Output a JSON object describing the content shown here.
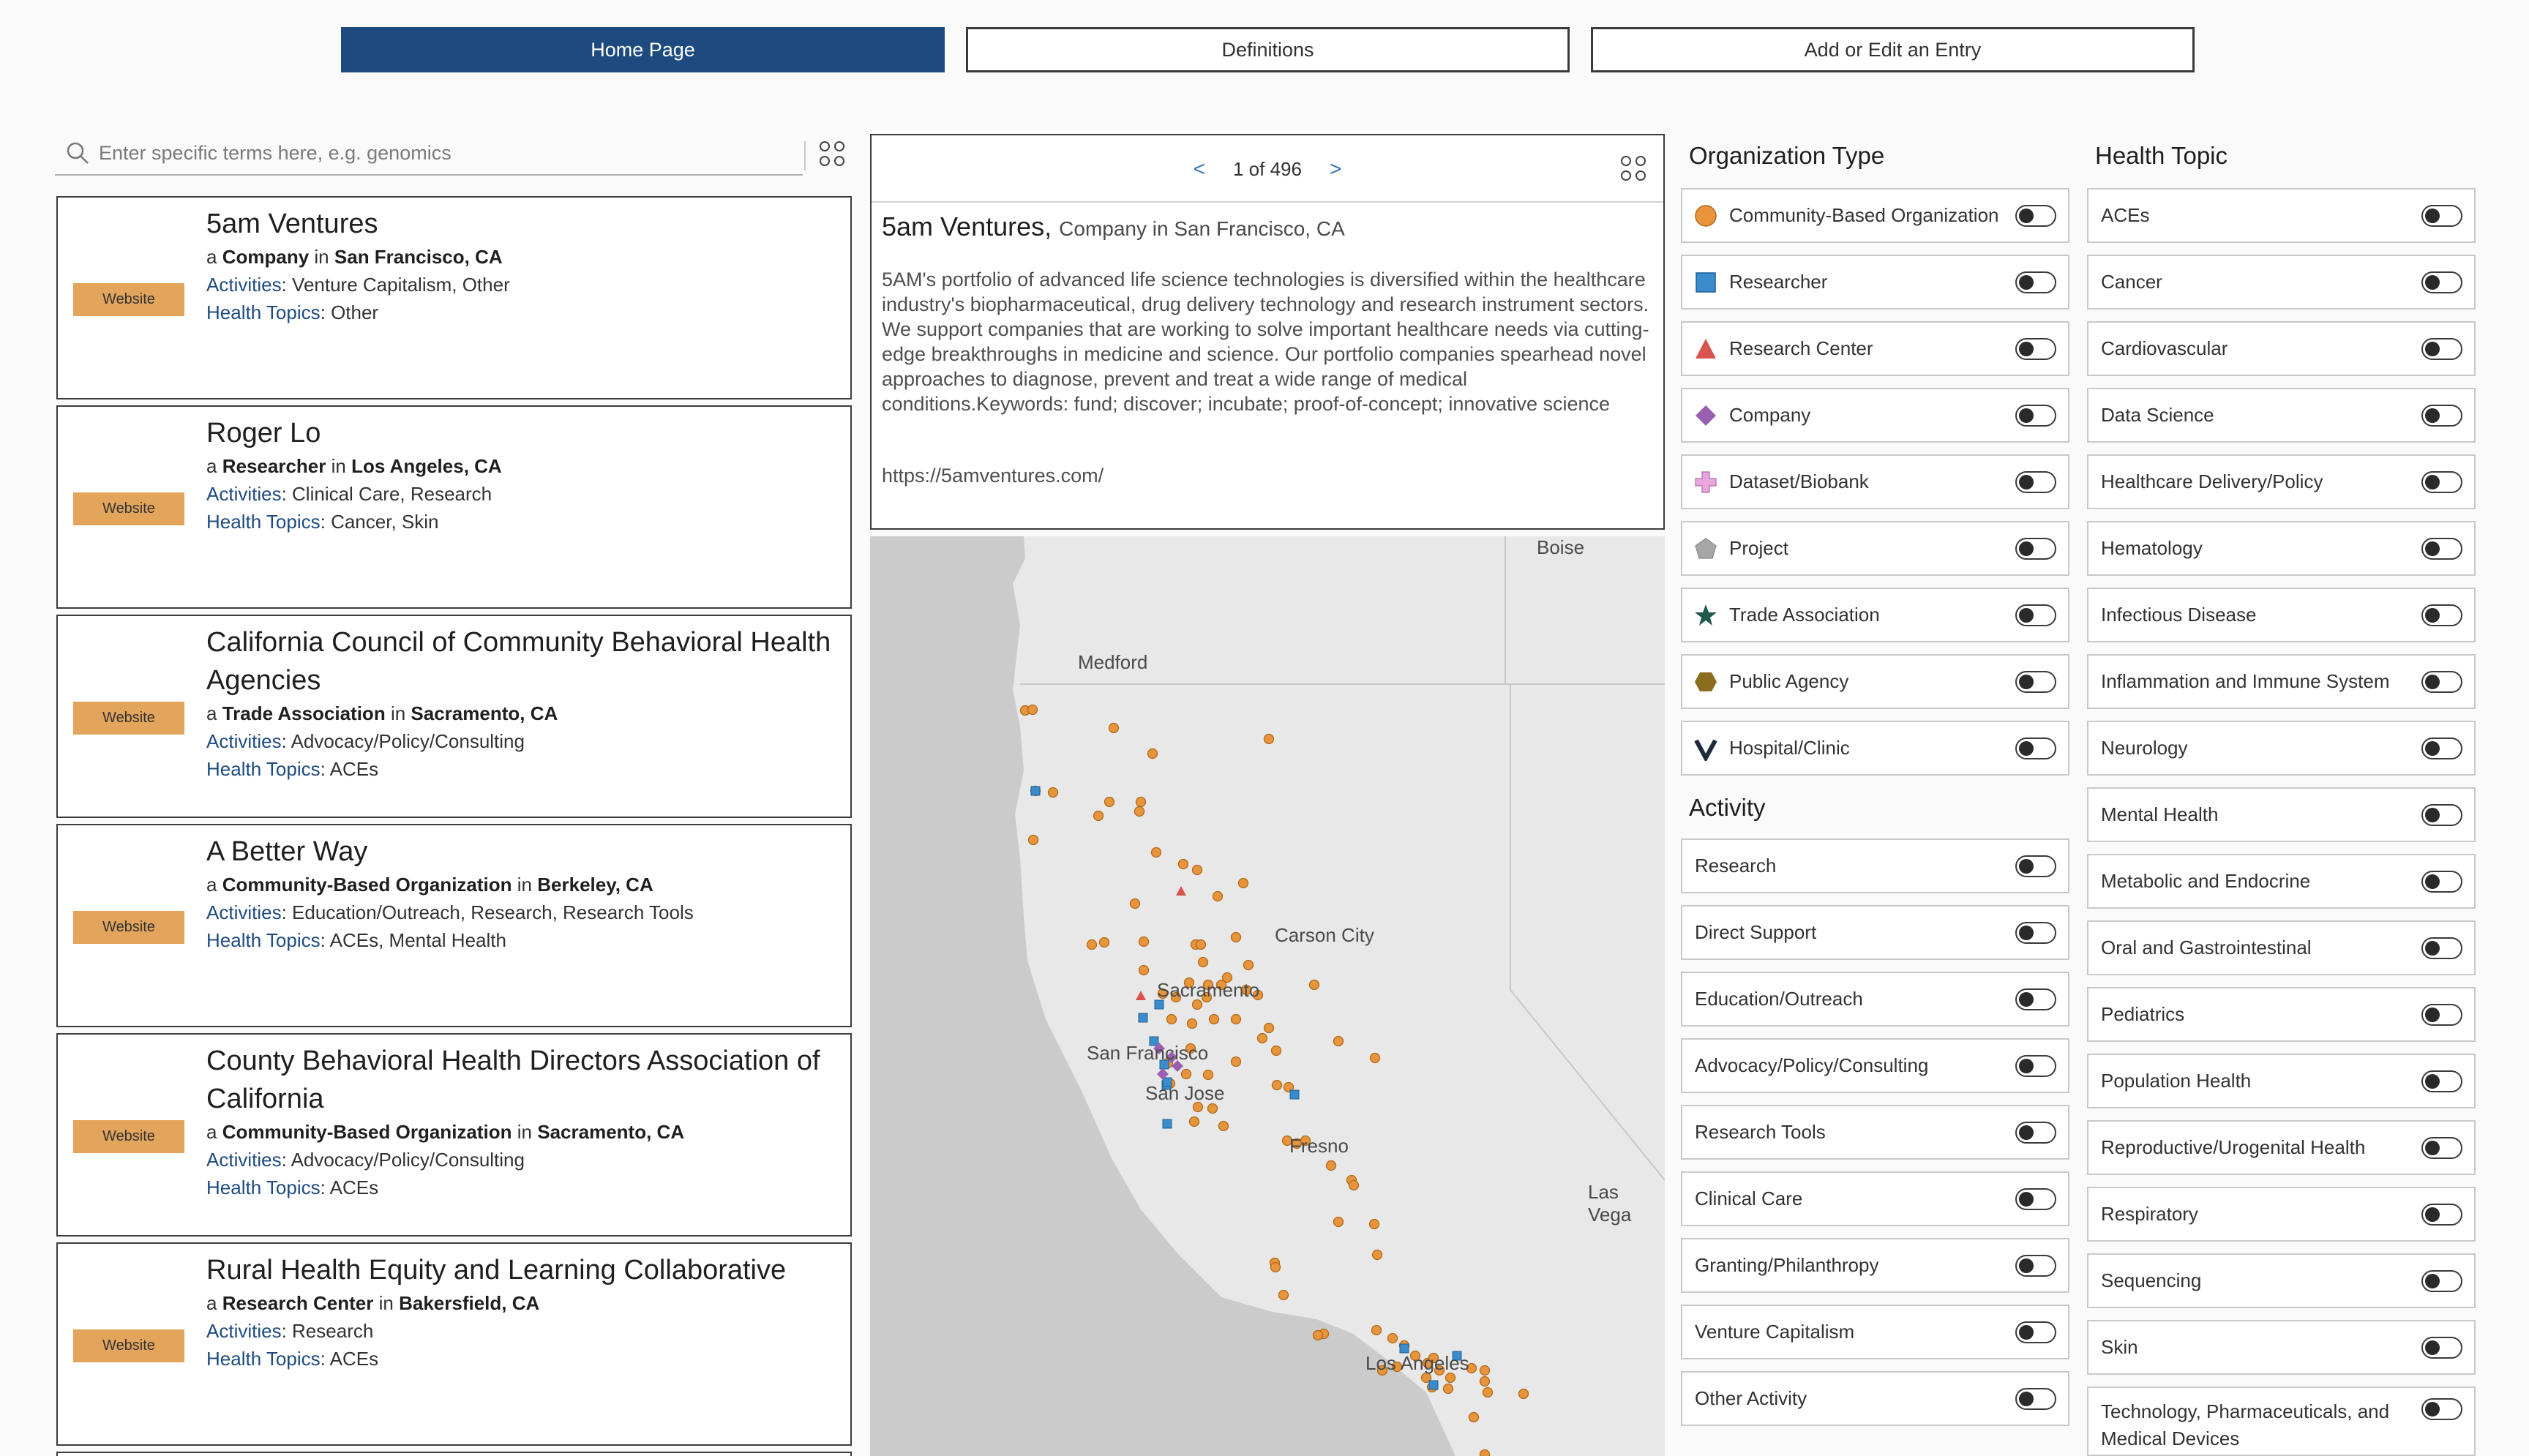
{
  "nav": {
    "home": "Home Page",
    "definitions": "Definitions",
    "add_edit": "Add or Edit an Entry"
  },
  "search": {
    "placeholder": "Enter specific terms here, e.g. genomics"
  },
  "labels": {
    "website": "Website",
    "a": "a",
    "in": "in",
    "activities": "Activities",
    "health_topics": "Health Topics"
  },
  "results": [
    {
      "name": "5am Ventures",
      "type": "Company",
      "location": "San Francisco, CA",
      "activities": "Venture Capitalism, Other",
      "topics": "Other"
    },
    {
      "name": "Roger Lo",
      "type": "Researcher",
      "location": "Los Angeles, CA",
      "activities": "Clinical Care, Research",
      "topics": "Cancer, Skin"
    },
    {
      "name": "California Council of Community Behavioral Health Agencies",
      "type": "Trade Association",
      "location": "Sacramento, CA",
      "activities": "Advocacy/Policy/Consulting",
      "topics": "ACEs"
    },
    {
      "name": "A Better Way",
      "type": "Community-Based Organization",
      "location": "Berkeley, CA",
      "activities": "Education/Outreach, Research, Research Tools",
      "topics": "ACEs, Mental Health"
    },
    {
      "name": "County Behavioral Health Directors Association of California",
      "type": "Community-Based Organization",
      "location": "Sacramento, CA",
      "activities": "Advocacy/Policy/Consulting",
      "topics": "ACEs"
    },
    {
      "name": "Rural Health Equity and Learning Collaborative",
      "type": "Research Center",
      "location": "Bakersfield, CA",
      "activities": "Research",
      "topics": "ACEs"
    }
  ],
  "popup": {
    "prev": "<",
    "next": ">",
    "page": "1 of 496",
    "title": "5am Ventures,",
    "subtitle": "Company in San Francisco, CA",
    "description": "5AM's portfolio of advanced life science technologies is diversified within the healthcare industry's biopharmaceutical, drug delivery technology and research instrument sectors. We support companies that are working to solve important healthcare needs via cutting-edge breakthroughs in medicine and science. Our portfolio companies spearhead novel approaches to diagnose, prevent and treat a wide range of medical conditions.Keywords: fund; discover; incubate; proof-of-concept; innovative science",
    "url": "https://5amventures.com/"
  },
  "map": {
    "labels": {
      "boise": "Boise",
      "medford": "Medford",
      "carson": "Carson City",
      "sacramento": "Sacramento",
      "sf": "San Francisco",
      "sanjose": "San Jose",
      "fresno": "Fresno",
      "lasvegas": "Las Vega",
      "la": "Los Angeles"
    }
  },
  "filters": {
    "org_title": "Organization Type",
    "org_types": [
      {
        "label": "Community-Based Organization",
        "icon": "circle-icon",
        "color": "#e8943a"
      },
      {
        "label": "Researcher",
        "icon": "square-icon",
        "color": "#3a8ccc"
      },
      {
        "label": "Research Center",
        "icon": "triangle-icon",
        "color": "#d9534f"
      },
      {
        "label": "Company",
        "icon": "diamond-icon",
        "color": "#9b5fb0"
      },
      {
        "label": "Dataset/Biobank",
        "icon": "cross-icon",
        "color": "#e8a6df"
      },
      {
        "label": "Project",
        "icon": "pentagon-icon",
        "color": "#a6a6a6"
      },
      {
        "label": "Trade Association",
        "icon": "star-icon",
        "color": "#1f5a4a"
      },
      {
        "label": "Public Agency",
        "icon": "hexagon-icon",
        "color": "#8a6d1f"
      },
      {
        "label": "Hospital/Clinic",
        "icon": "chevron-icon",
        "color": "#1f2a3a"
      }
    ],
    "activity_title": "Activity",
    "activities": [
      "Research",
      "Direct Support",
      "Education/Outreach",
      "Advocacy/Policy/Consulting",
      "Research Tools",
      "Clinical Care",
      "Granting/Philanthropy",
      "Venture Capitalism",
      "Other Activity"
    ],
    "health_title": "Health Topic",
    "health_topics": [
      "ACEs",
      "Cancer",
      "Cardiovascular",
      "Data Science",
      "Healthcare Delivery/Policy",
      "Hematology",
      "Infectious Disease",
      "Inflammation and Immune System",
      "Neurology",
      "Mental Health",
      "Metabolic and Endocrine",
      "Oral and Gastrointestinal",
      "Pediatrics",
      "Population Health",
      "Reproductive/Urogenital Health",
      "Respiratory",
      "Sequencing",
      "Skin",
      "Technology, Pharmaceuticals, and Medical Devices"
    ]
  }
}
